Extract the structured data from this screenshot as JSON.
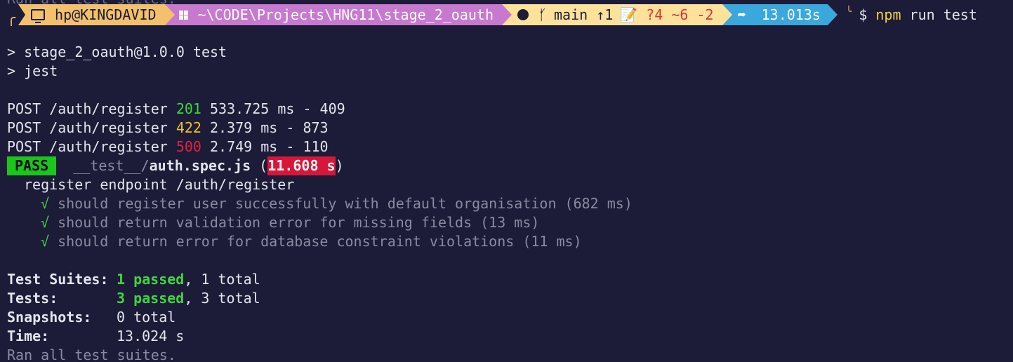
{
  "prompt": {
    "corner_top": "╭",
    "corner_bottom": "╰",
    "user_host": "hp@KINGDAVID",
    "path": "~\\CODE\\Projects\\HNG11\\stage_2_oauth",
    "git": {
      "branch": "main ↑1",
      "changes": "📝 ?4 ~6 -2"
    },
    "duration": "13.013s",
    "symbol": "$",
    "command_name": "npm",
    "command_args": " run test",
    "colors": {
      "user_host_bg": "#f3c16b",
      "path_bg": "#c779d0",
      "git_bg": "#ffe29a",
      "duration_bg": "#3aa7dd"
    }
  },
  "output": {
    "ghost_line": "Ran all test suites.",
    "script_line1": "> stage_2_oauth@1.0.0 test",
    "script_line2": "> jest",
    "requests": [
      {
        "prefix": "POST /auth/register ",
        "status": "201",
        "suffix": " 533.725 ms - 409"
      },
      {
        "prefix": "POST /auth/register ",
        "status": "422",
        "suffix": " 2.379 ms - 873"
      },
      {
        "prefix": "POST /auth/register ",
        "status": "500",
        "suffix": " 2.749 ms - 110"
      }
    ],
    "pass_label": "PASS",
    "spec_dir": "__test__/",
    "spec_file": "auth.spec.js",
    "spec_time_open": " (",
    "spec_time": "11.608 s",
    "spec_time_close": ")",
    "describe": "register endpoint /auth/register",
    "check_mark": "√",
    "tests": [
      "should register user successfully with default organisation (682 ms)",
      "should return validation error for missing fields (13 ms)",
      "should return error for database constraint violations (11 ms)"
    ],
    "summary": {
      "suites_label": "Test Suites:",
      "suites_passed": "1 passed",
      "suites_total": ", 1 total",
      "tests_label": "Tests:",
      "tests_passed": "3 passed",
      "tests_total": ", 3 total",
      "snapshots_label": "Snapshots:",
      "snapshots_value": "0 total",
      "time_label": "Time:",
      "time_value": "13.024 s",
      "ran_all": "Ran all test suites."
    }
  }
}
